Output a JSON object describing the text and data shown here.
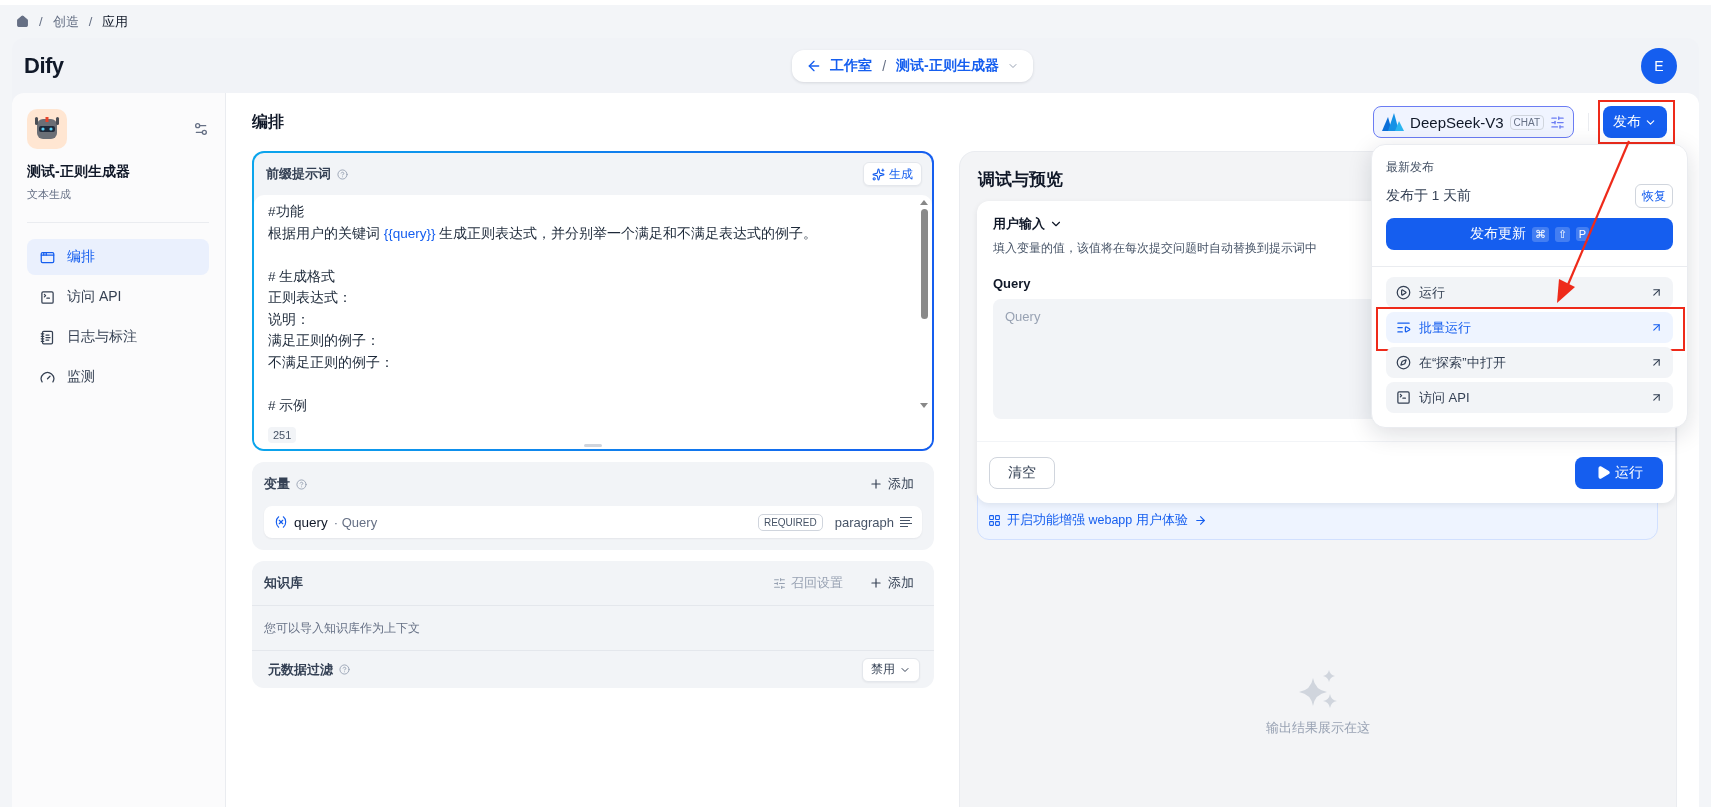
{
  "breadcrumb": {
    "separator": "/",
    "items": [
      {
        "label": "创造",
        "current": false
      },
      {
        "label": "应用",
        "current": true
      }
    ]
  },
  "header": {
    "logo": "Dify",
    "nav": {
      "back": "工作室",
      "separator": "/",
      "app": "测试-正则生成器"
    },
    "avatar": "E"
  },
  "sidebar": {
    "app_name": "测试-正则生成器",
    "app_type": "文本生成",
    "items": [
      {
        "label": "编排",
        "selected": true
      },
      {
        "label": "访问 API",
        "selected": false
      },
      {
        "label": "日志与标注",
        "selected": false
      },
      {
        "label": "监测",
        "selected": false
      }
    ]
  },
  "workspace": {
    "title": "编排",
    "model": {
      "name": "DeepSeek-V3",
      "tag": "CHAT"
    },
    "publish": "发布",
    "publish_annotated": true
  },
  "prompt": {
    "title": "前缀提示词",
    "generate": "生成",
    "count": "251",
    "lines": [
      {
        "kind": "text",
        "segments": [
          {
            "kind": "text",
            "text": "#功能"
          }
        ]
      },
      {
        "kind": "text",
        "segments": [
          {
            "kind": "text",
            "text": "根据用户的关键词 "
          },
          {
            "kind": "variable",
            "text": "{{query}}"
          },
          {
            "kind": "text",
            "text": " 生成正则表达式，并分别举一个满足和不满足表达式的例子。"
          }
        ]
      },
      {
        "kind": "blank"
      },
      {
        "kind": "text",
        "segments": [
          {
            "kind": "text",
            "text": "# 生成格式"
          }
        ]
      },
      {
        "kind": "text",
        "segments": [
          {
            "kind": "text",
            "text": "正则表达式："
          }
        ]
      },
      {
        "kind": "text",
        "segments": [
          {
            "kind": "text",
            "text": "说明："
          }
        ]
      },
      {
        "kind": "text",
        "segments": [
          {
            "kind": "text",
            "text": "满足正则的例子："
          }
        ]
      },
      {
        "kind": "text",
        "segments": [
          {
            "kind": "text",
            "text": "不满足正则的例子："
          }
        ]
      },
      {
        "kind": "blank"
      },
      {
        "kind": "text",
        "segments": [
          {
            "kind": "text",
            "text": "# 示例"
          }
        ]
      }
    ]
  },
  "variables": {
    "title": "变量",
    "add": "添加",
    "items": [
      {
        "key": "query",
        "separator": "·",
        "name": "Query",
        "badge": "REQUIRED",
        "type": "paragraph"
      }
    ]
  },
  "knowledge": {
    "title": "知识库",
    "retrieval": {
      "label": "召回设置",
      "disabled": true
    },
    "add": "添加",
    "hint": "您可以导入知识库作为上下文",
    "metadata_filter": {
      "label": "元数据过滤",
      "value": "禁用"
    }
  },
  "debug": {
    "title": "调试与预览",
    "user_input": {
      "title": "用户输入",
      "expanded": true,
      "hint": "填入变量的值，该值将在每次提交问题时自动替换到提示词中",
      "fields": [
        {
          "label": "Query",
          "placeholder": "Query"
        }
      ]
    },
    "clear": "清空",
    "run": "运行",
    "feature_link": "开启功能增强 webapp 用户体验",
    "empty": "输出结果展示在这"
  },
  "publish_menu": {
    "section": "最新发布",
    "published_at": "发布于 1 天前",
    "restore": "恢复",
    "update": {
      "label": "发布更新",
      "keys": [
        "⌘",
        "⇧",
        "P"
      ]
    },
    "items": [
      {
        "label": "运行",
        "selected": false,
        "annotated": false
      },
      {
        "label": "批量运行",
        "selected": true,
        "annotated": true
      },
      {
        "label": "在“探索”中打开",
        "selected": false,
        "annotated": false
      },
      {
        "label": "访问 API",
        "selected": false,
        "annotated": false
      }
    ]
  }
}
